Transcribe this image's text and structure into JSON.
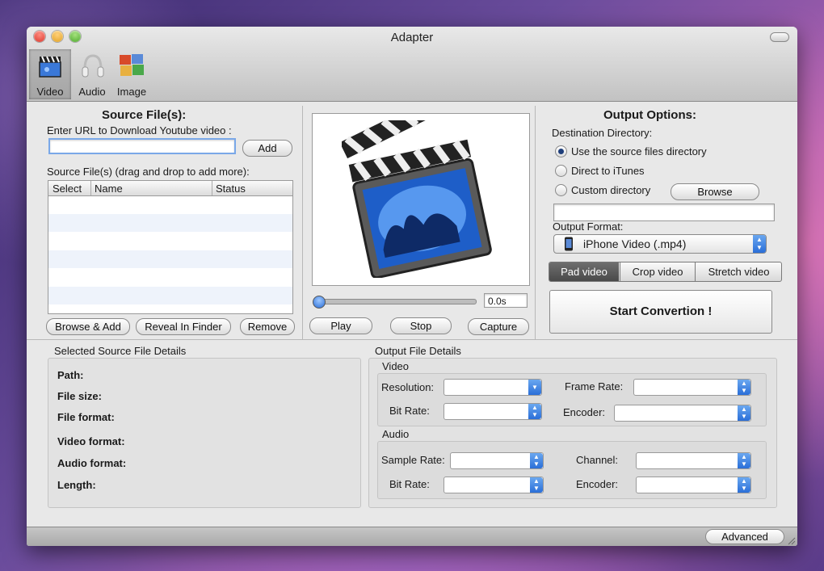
{
  "window": {
    "title": "Adapter"
  },
  "toolbar": {
    "items": [
      {
        "label": "Video",
        "icon": "clapperboard-icon",
        "selected": true
      },
      {
        "label": "Audio",
        "icon": "headphones-icon"
      },
      {
        "label": "Image",
        "icon": "photos-icon"
      }
    ]
  },
  "source": {
    "title": "Source File(s):",
    "url_label": "Enter URL to Download Youtube video :",
    "url_value": "",
    "add_button": "Add",
    "list_label": "Source File(s) (drag and drop to add more):",
    "columns": [
      "Select",
      "Name",
      "Status"
    ],
    "rows": [],
    "browse_add": "Browse & Add",
    "reveal": "Reveal In Finder",
    "remove": "Remove"
  },
  "preview": {
    "time": "0.0s",
    "progress": 0,
    "play": "Play",
    "stop": "Stop",
    "capture": "Capture"
  },
  "output": {
    "title": "Output Options:",
    "dest_label": "Destination Directory:",
    "options": [
      "Use the source files directory",
      "Direct to iTunes",
      "Custom directory"
    ],
    "selected_option": 0,
    "browse": "Browse",
    "custom_path": "",
    "format_label": "Output Format:",
    "format_value": "iPhone Video (.mp4)",
    "modes": [
      "Pad video",
      "Crop video",
      "Stretch video"
    ],
    "selected_mode": 0,
    "start": "Start Convertion !"
  },
  "details": {
    "title": "Selected Source File Details",
    "path": "Path:",
    "file_size": "File size:",
    "file_format": "File format:",
    "video_format": "Video format:",
    "audio_format": "Audio format:",
    "length": "Length:"
  },
  "output_details": {
    "title": "Output File Details",
    "video_group": "Video",
    "resolution": "Resolution:",
    "frame_rate": "Frame Rate:",
    "video_bit_rate": "Bit Rate:",
    "video_encoder": "Encoder:",
    "audio_group": "Audio",
    "sample_rate": "Sample Rate:",
    "channel": "Channel:",
    "audio_bit_rate": "Bit Rate:",
    "audio_encoder": "Encoder:"
  },
  "footer": {
    "advanced": "Advanced"
  },
  "colors": {
    "accent": "#2a6ed8",
    "selected_segment": "#5a5a5a"
  }
}
